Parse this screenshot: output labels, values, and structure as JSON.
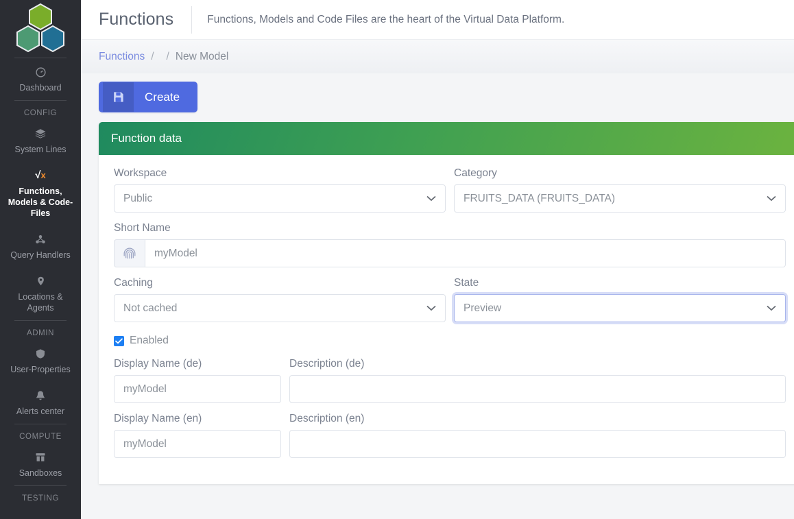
{
  "sidebar": {
    "logo_name": "hexagon-logo",
    "logo_colors": [
      "#7aad2a",
      "#4d9a73",
      "#216f94"
    ],
    "items": [
      {
        "label": "Dashboard",
        "icon": "dashboard-icon",
        "active": false
      },
      {
        "label": "System Lines",
        "icon": "layers-icon",
        "active": false
      },
      {
        "label": "Functions, Models & Code-Files",
        "icon": "sqrt-x-icon",
        "active": true
      },
      {
        "label": "Query Handlers",
        "icon": "molecule-icon",
        "active": false
      },
      {
        "label": "Locations & Agents",
        "icon": "map-pin-icon",
        "active": false
      },
      {
        "label": "User-Properties",
        "icon": "shield-icon",
        "active": false
      },
      {
        "label": "Alerts center",
        "icon": "bell-icon",
        "active": false
      },
      {
        "label": "Sandboxes",
        "icon": "box-icon",
        "active": false
      }
    ],
    "groups": {
      "config": "CONFIG",
      "admin": "ADMIN",
      "compute": "COMPUTE",
      "testing": "TESTING"
    }
  },
  "header": {
    "title": "Functions",
    "subtitle": "Functions, Models and Code Files are the heart of the Virtual Data Platform."
  },
  "breadcrumb": {
    "root": "Functions",
    "separator": "/",
    "middle": "",
    "current": "New Model"
  },
  "toolbar": {
    "create_label": "Create",
    "create_icon": "save-icon"
  },
  "card": {
    "title": "Function data",
    "accent_from": "#1f8a5f",
    "accent_to": "#6cb33f",
    "fields": {
      "workspace": {
        "label": "Workspace",
        "value": "Public"
      },
      "category": {
        "label": "Category",
        "value": "FRUITS_DATA (FRUITS_DATA)"
      },
      "short_name": {
        "label": "Short Name",
        "value": "myModel",
        "icon": "fingerprint-icon"
      },
      "caching": {
        "label": "Caching",
        "value": "Not cached"
      },
      "state": {
        "label": "State",
        "value": "Preview",
        "focused": true
      },
      "enabled": {
        "label": "Enabled",
        "checked": true
      },
      "display_name_de": {
        "label": "Display Name (de)",
        "value": "myModel"
      },
      "description_de": {
        "label": "Description (de)",
        "value": ""
      },
      "display_name_en": {
        "label": "Display Name (en)",
        "value": "myModel"
      },
      "description_en": {
        "label": "Description (en)",
        "value": ""
      }
    }
  }
}
